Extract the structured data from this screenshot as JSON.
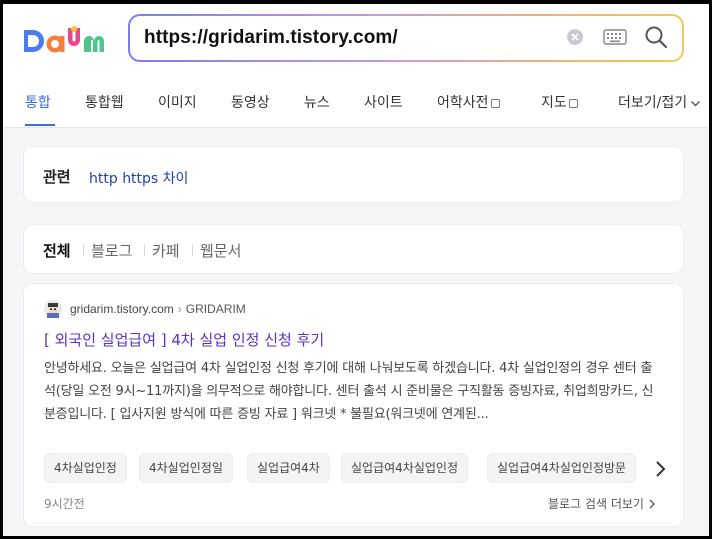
{
  "colors": {
    "accent": "#3b6fd8",
    "link": "#2440b0",
    "title_link": "#5b30c8",
    "logo_blue": "#4a7cf0",
    "logo_orange": "#f57f3c",
    "logo_pink": "#e8478e",
    "logo_yellow": "#f5c330",
    "logo_green": "#4cc48b"
  },
  "logo": {
    "text": "Daum"
  },
  "search": {
    "value": "https://gridarim.tistory.com/",
    "icons": [
      "clear-icon",
      "keyboard-icon",
      "search-icon"
    ]
  },
  "tabs": [
    {
      "label": "통합",
      "active": true
    },
    {
      "label": "통합웹"
    },
    {
      "label": "이미지"
    },
    {
      "label": "동영상"
    },
    {
      "label": "뉴스"
    },
    {
      "label": "사이트"
    },
    {
      "label": "어학사전",
      "box": true
    },
    {
      "label": "지도",
      "box": true
    },
    {
      "label": "더보기/접기",
      "chevron": true
    }
  ],
  "related": {
    "label": "관련",
    "link": "http https 차이"
  },
  "filters": [
    {
      "label": "전체",
      "active": true
    },
    {
      "label": "블로그"
    },
    {
      "label": "카페"
    },
    {
      "label": "웹문서"
    }
  ],
  "result": {
    "site": "gridarim.tistory.com",
    "blog_name": "GRIDARIM",
    "title": "[ 외국인 실업급여 ] 4차 실업 인정 신청 후기",
    "snippet": "안녕하세요. 오늘은 실업급여 4차 실업인정 신청 후기에 대해 나눠보도록 하겠습니다. 4차 실업인정의 경우 센터 출석(당일 오전 9시~11까지)을 의무적으로 해야합니다. 센터 출석 시 준비물은 구직활동 증빙자료, 취업희망카드, 신분증입니다. [ 입사지원 방식에 따른 증빙 자료 ] 워크넷  * 불필요(워크넷에 연계된...",
    "chips": [
      "4차실업인정",
      "4차실업인정일",
      "실업급여4차",
      "실업급여4차실업인정",
      "실업급여4차실업인정방문"
    ],
    "time": "9시간전",
    "more": "블로그 검색 더보기"
  }
}
